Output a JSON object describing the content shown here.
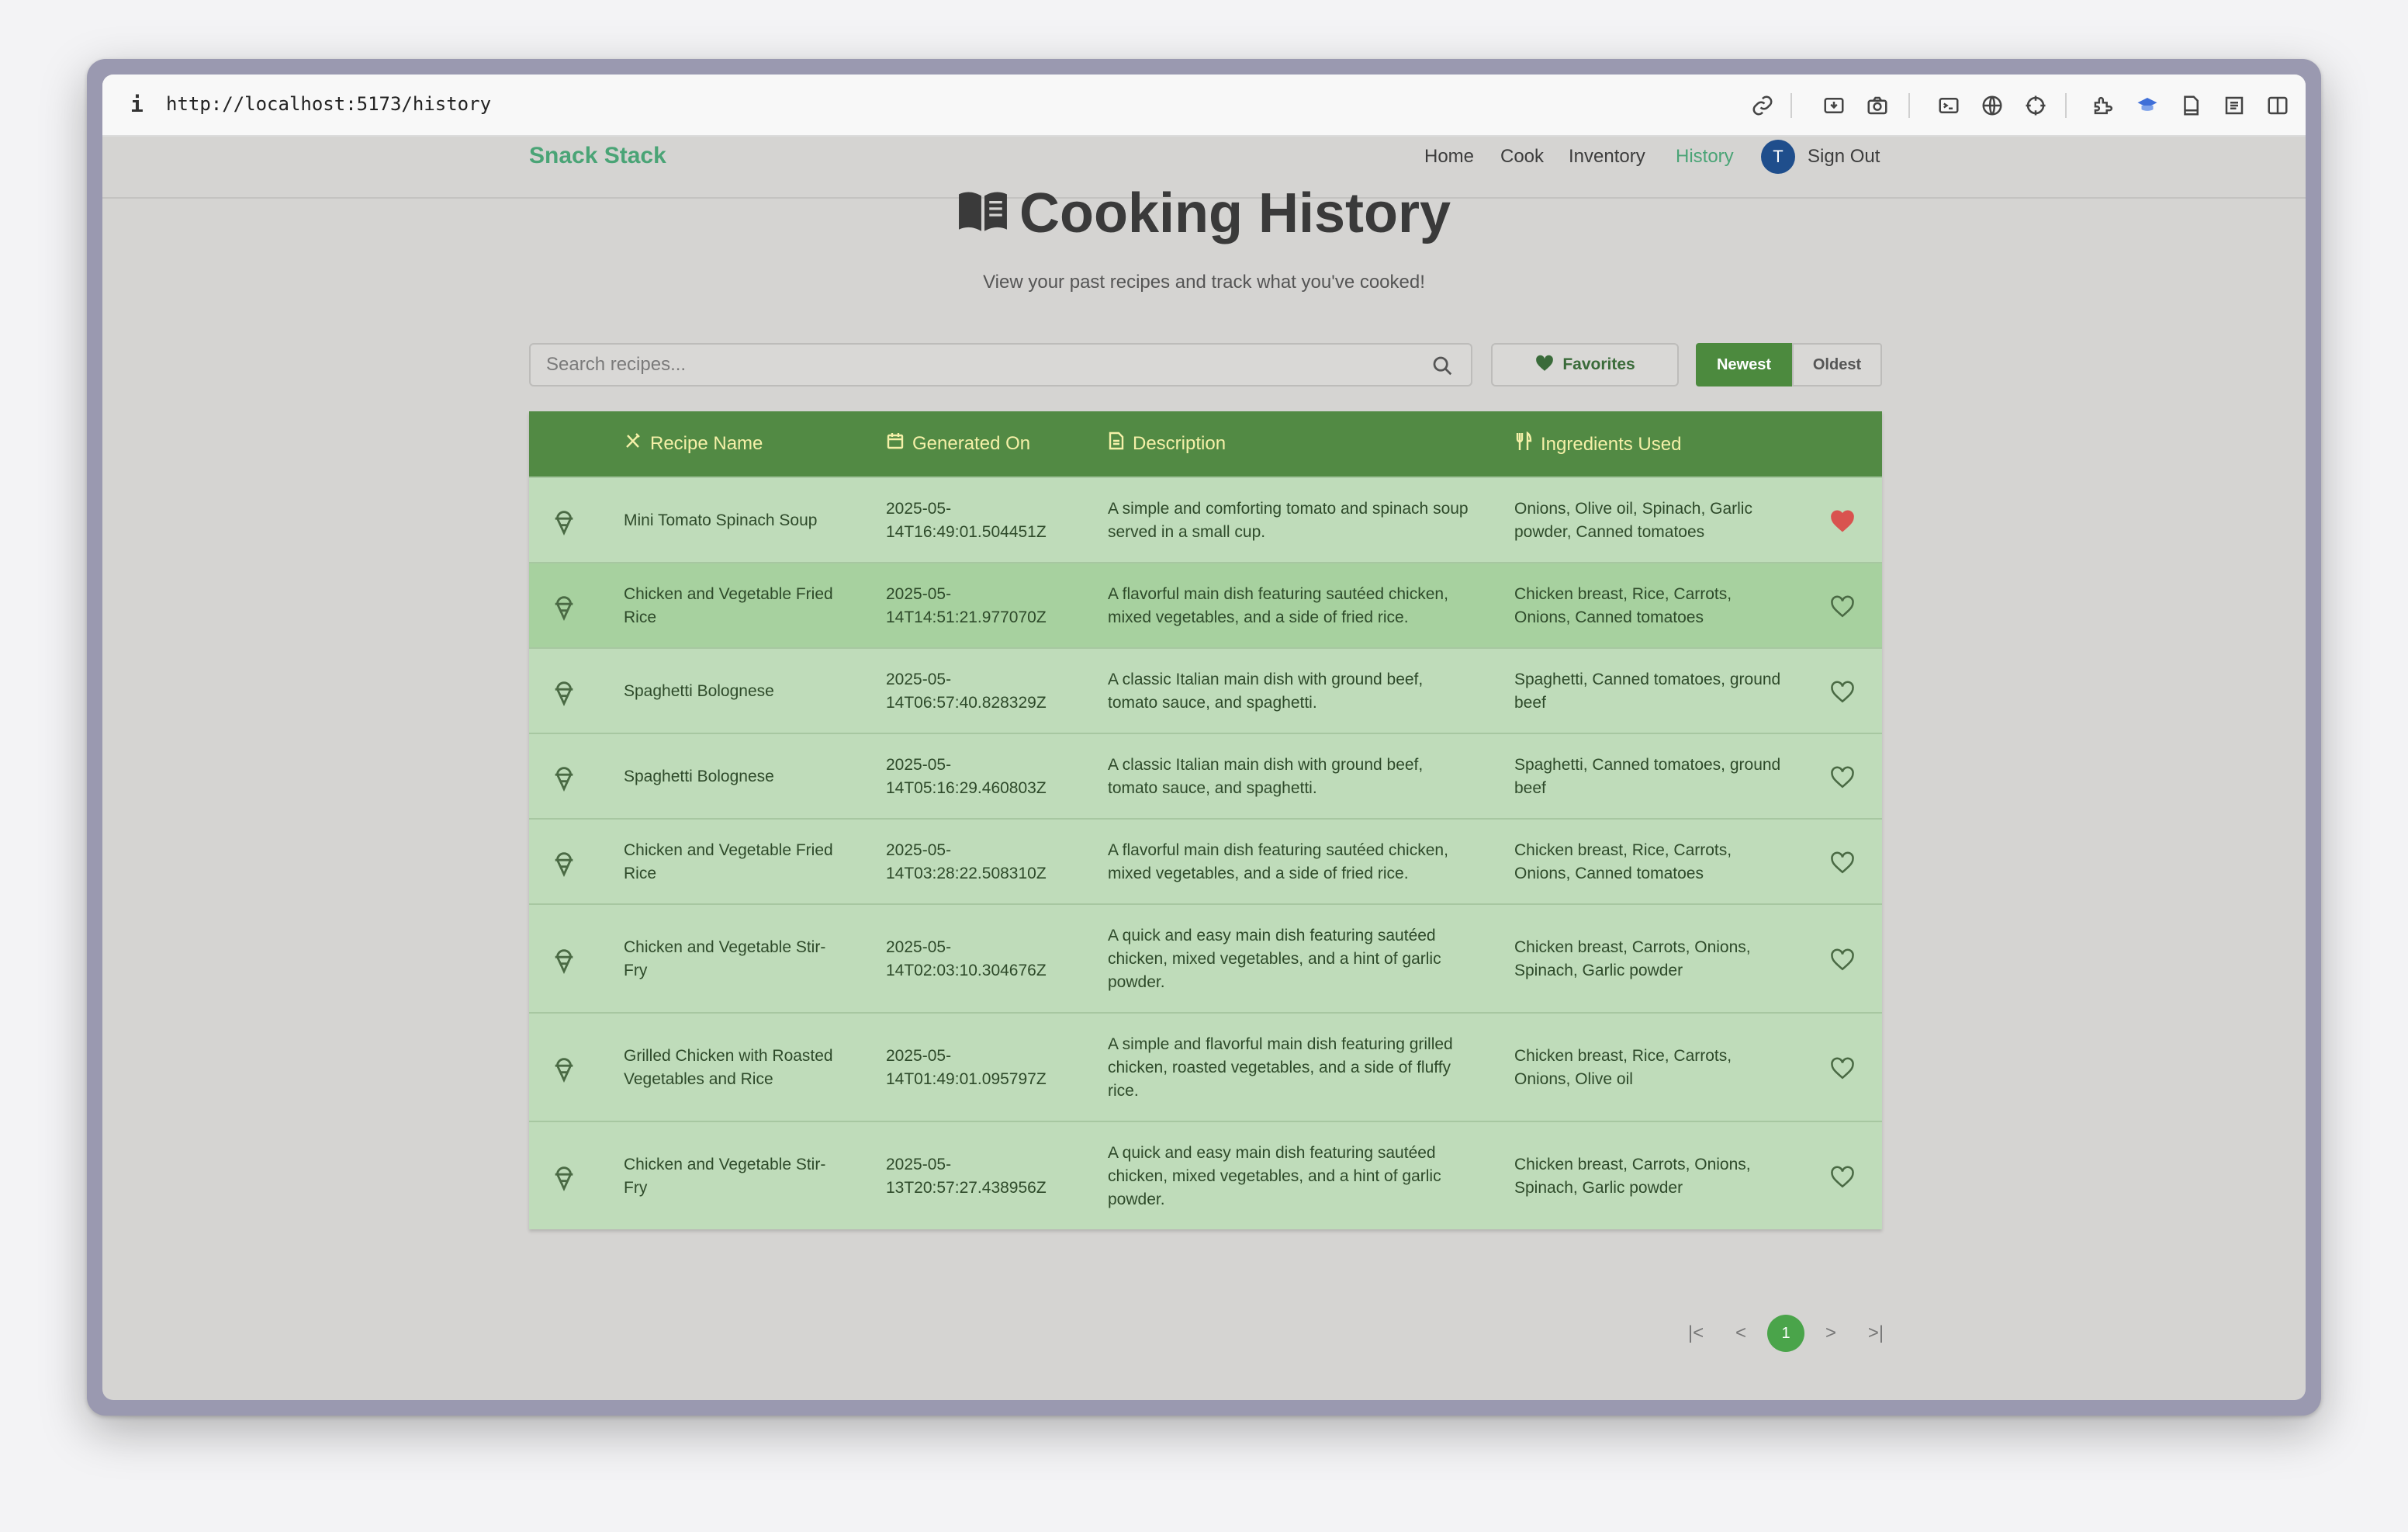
{
  "browser": {
    "url": "http://localhost:5173/history",
    "info_icon": "i"
  },
  "nav": {
    "brand": "Snack Stack",
    "links": [
      "Home",
      "Cook",
      "Inventory",
      "History"
    ],
    "active": "History",
    "avatar_initial": "T",
    "sign_out": "Sign Out"
  },
  "page": {
    "title": "Cooking History",
    "subtitle": "View your past recipes and track what you've cooked!"
  },
  "controls": {
    "search_placeholder": "Search recipes...",
    "favorites_label": "Favorites",
    "sort_newest": "Newest",
    "sort_oldest": "Oldest",
    "active_sort": "Newest"
  },
  "table": {
    "headers": {
      "name": "Recipe Name",
      "date": "Generated On",
      "description": "Description",
      "ingredients": "Ingredients Used"
    },
    "rows": [
      {
        "name": [
          "Mini Tomato Spinach Soup"
        ],
        "date": [
          "2025-05-",
          "14T16:49:01.504451Z"
        ],
        "desc": [
          "A simple and comforting tomato and spinach soup",
          "served in a small cup."
        ],
        "ing": [
          "Onions, Olive oil, Spinach, Garlic",
          "powder, Canned tomatoes"
        ],
        "favorite": true
      },
      {
        "name": [
          "Chicken and Vegetable Fried",
          "Rice"
        ],
        "date": [
          "2025-05-",
          "14T14:51:21.977070Z"
        ],
        "desc": [
          "A flavorful main dish featuring sautéed chicken,",
          "mixed vegetables, and a side of fried rice."
        ],
        "ing": [
          "Chicken breast, Rice, Carrots,",
          "Onions, Canned tomatoes"
        ],
        "favorite": false
      },
      {
        "name": [
          "Spaghetti Bolognese"
        ],
        "date": [
          "2025-05-",
          "14T06:57:40.828329Z"
        ],
        "desc": [
          "A classic Italian main dish with ground beef,",
          "tomato sauce, and spaghetti."
        ],
        "ing": [
          "Spaghetti, Canned tomatoes, ground",
          "beef"
        ],
        "favorite": false
      },
      {
        "name": [
          "Spaghetti Bolognese"
        ],
        "date": [
          "2025-05-",
          "14T05:16:29.460803Z"
        ],
        "desc": [
          "A classic Italian main dish with ground beef,",
          "tomato sauce, and spaghetti."
        ],
        "ing": [
          "Spaghetti, Canned tomatoes, ground",
          "beef"
        ],
        "favorite": false
      },
      {
        "name": [
          "Chicken and Vegetable Fried",
          "Rice"
        ],
        "date": [
          "2025-05-",
          "14T03:28:22.508310Z"
        ],
        "desc": [
          "A flavorful main dish featuring sautéed chicken,",
          "mixed vegetables, and a side of fried rice."
        ],
        "ing": [
          "Chicken breast, Rice, Carrots,",
          "Onions, Canned tomatoes"
        ],
        "favorite": false
      },
      {
        "name": [
          "Chicken and Vegetable Stir-",
          "Fry"
        ],
        "date": [
          "2025-05-",
          "14T02:03:10.304676Z"
        ],
        "desc": [
          "A quick and easy main dish featuring sautéed",
          "chicken, mixed vegetables, and a hint of garlic",
          "powder."
        ],
        "ing": [
          "Chicken breast, Carrots, Onions,",
          "Spinach, Garlic powder"
        ],
        "favorite": false
      },
      {
        "name": [
          "Grilled Chicken with Roasted",
          "Vegetables and Rice"
        ],
        "date": [
          "2025-05-",
          "14T01:49:01.095797Z"
        ],
        "desc": [
          "A simple and flavorful main dish featuring grilled",
          "chicken, roasted vegetables, and a side of fluffy",
          "rice."
        ],
        "ing": [
          "Chicken breast, Rice, Carrots,",
          "Onions, Olive oil"
        ],
        "favorite": false
      },
      {
        "name": [
          "Chicken and Vegetable Stir-",
          "Fry"
        ],
        "date": [
          "2025-05-",
          "13T20:57:27.438956Z"
        ],
        "desc": [
          "A quick and easy main dish featuring sautéed",
          "chicken, mixed vegetables, and a hint of garlic",
          "powder."
        ],
        "ing": [
          "Chicken breast, Carrots, Onions,",
          "Spinach, Garlic powder"
        ],
        "favorite": false
      }
    ]
  },
  "pagination": {
    "current_page": "1",
    "first": "|<",
    "prev": "<",
    "next": ">",
    "last": ">|"
  },
  "colors": {
    "brand": "#4aa476",
    "header_bg": "#528a44",
    "header_text": "#f5f0a8",
    "row_bg": "#bfdcba",
    "row_highlight": "#a7d19f",
    "favorite": "#d9534f"
  },
  "icons": {
    "title": "open-book-icon",
    "row": "ice-cream-icon",
    "favorite": "heart-icon"
  }
}
